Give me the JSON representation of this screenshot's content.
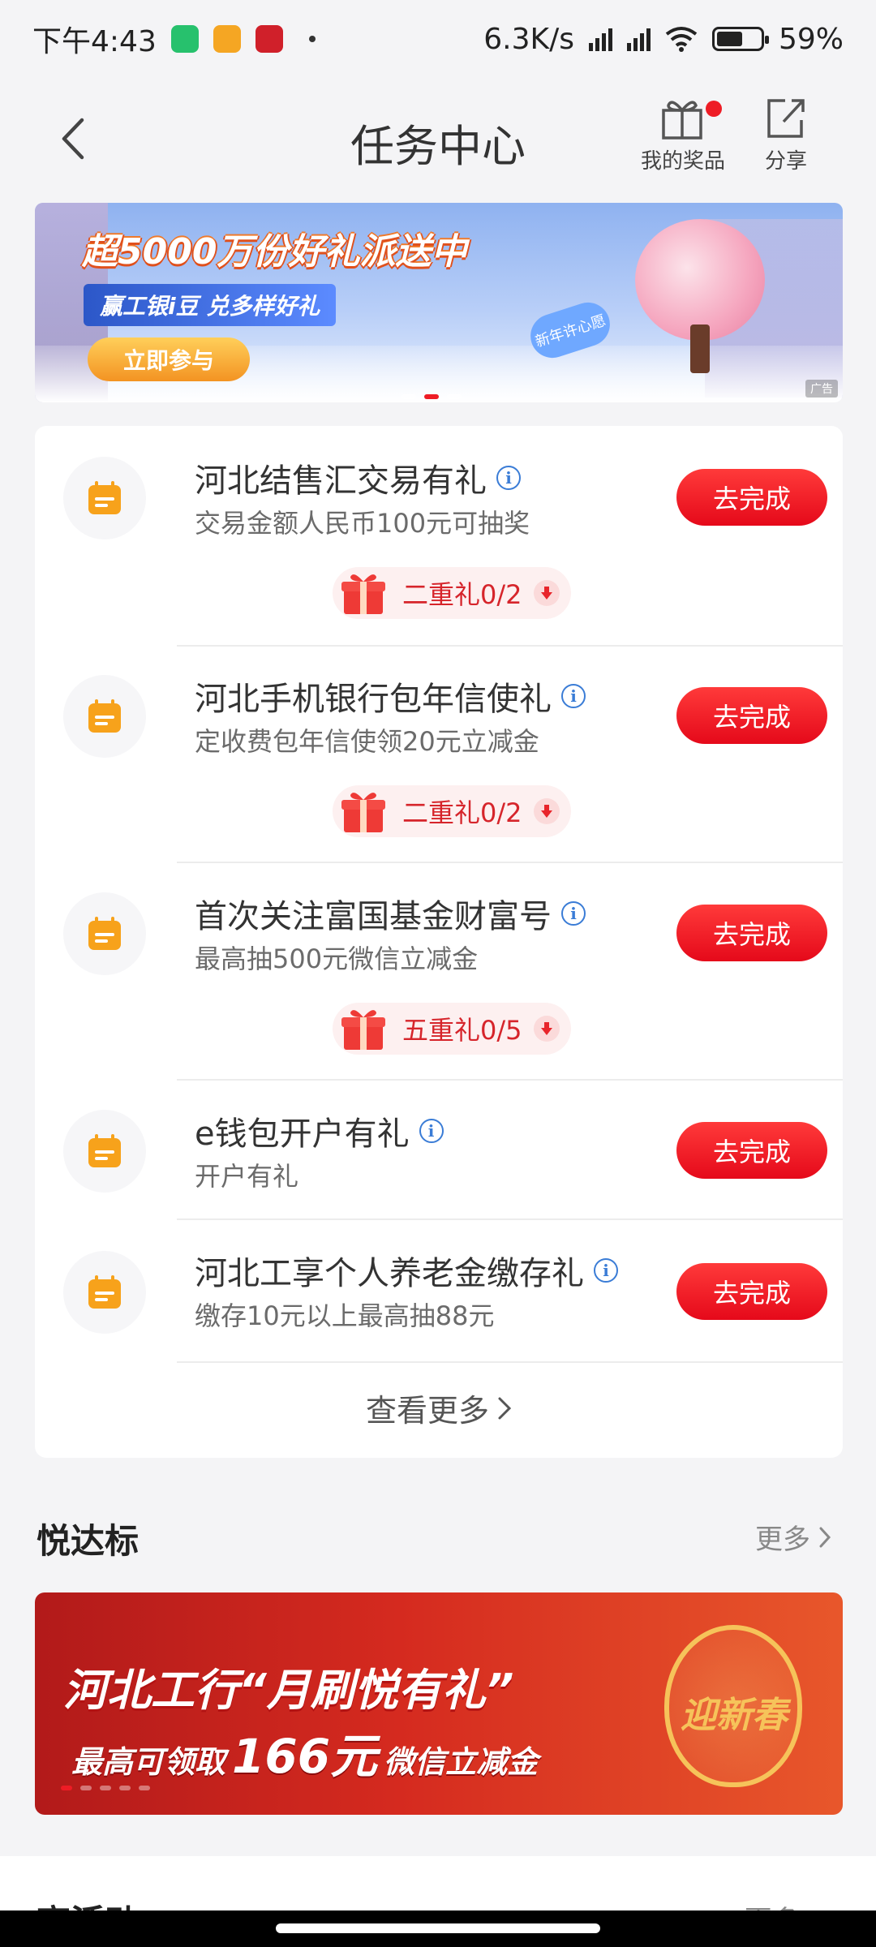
{
  "status_bar": {
    "time": "下午4:43",
    "speed": "6.3K/s",
    "battery": "59%",
    "battery_level": 0.59
  },
  "header": {
    "title": "任务中心",
    "prizes_label": "我的奖品",
    "share_label": "分享"
  },
  "banner": {
    "headline": "超5000万份好礼派送中",
    "subline": "赢工银i豆 兑多样好礼",
    "cta": "立即参与",
    "bubble": "新年许心愿",
    "ad_tag": "广告"
  },
  "tasks": [
    {
      "title": "河北结售汇交易有礼",
      "desc": "交易金额人民币100元可抽奖",
      "button": "去完成",
      "reward": "二重礼0/2"
    },
    {
      "title": "河北手机银行包年信使礼",
      "desc": "定收费包年信使领20元立减金",
      "button": "去完成",
      "reward": "二重礼0/2"
    },
    {
      "title": "首次关注富国基金财富号",
      "desc": "最高抽500元微信立减金",
      "button": "去完成",
      "reward": "五重礼0/5"
    },
    {
      "title": "e钱包开户有礼",
      "desc": "开户有礼",
      "button": "去完成"
    },
    {
      "title": "河北工享个人养老金缴存礼",
      "desc": "缴存10元以上最高抽88元",
      "button": "去完成"
    }
  ],
  "view_more": "查看更多",
  "section": {
    "title": "悦达标",
    "more": "更多"
  },
  "promo": {
    "line1": "河北工行“月刷悦有礼”",
    "line2_prefix": "最高可领取",
    "line2_amount": "166元",
    "line2_suffix": "微信立减金",
    "ornament_text": "迎新春"
  },
  "next_section": {
    "title": "高活动",
    "more": "更多 >"
  },
  "colors": {
    "accent_red": "#e5091a",
    "icon_orange": "#f7a21b",
    "info_blue": "#3a7cd6"
  }
}
